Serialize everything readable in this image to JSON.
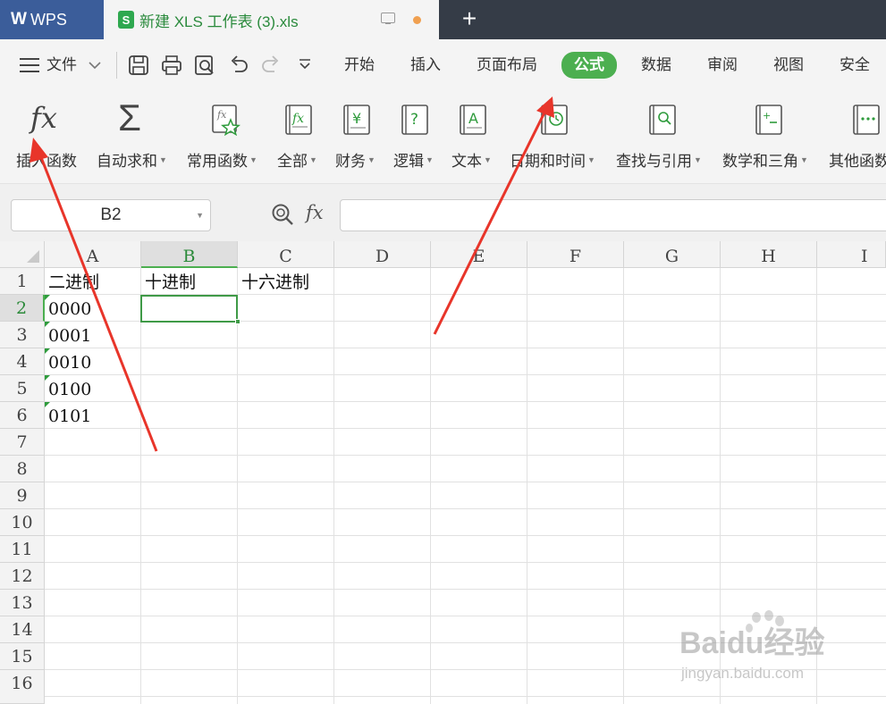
{
  "titlebar": {
    "app_name": "WPS",
    "logo": "W",
    "doc_icon_letter": "S",
    "doc_title": "新建 XLS 工作表 (3).xls",
    "new_tab_symbol": "+"
  },
  "menubar": {
    "file_label": "文件",
    "tabs": [
      "开始",
      "插入",
      "页面布局",
      "公式",
      "数据",
      "审阅",
      "视图",
      "安全"
    ],
    "active_tab": "公式"
  },
  "ribbon": {
    "buttons": [
      {
        "label": "插入函数",
        "icon": "fx-icon",
        "dropdown": false
      },
      {
        "label": "自动求和",
        "icon": "sigma-icon",
        "dropdown": true
      },
      {
        "label": "常用函数",
        "icon": "star-fx-icon",
        "dropdown": true
      },
      {
        "label": "全部",
        "icon": "fx-book-icon",
        "dropdown": true
      },
      {
        "label": "财务",
        "icon": "yen-book-icon",
        "dropdown": true
      },
      {
        "label": "逻辑",
        "icon": "question-book-icon",
        "dropdown": true
      },
      {
        "label": "文本",
        "icon": "a-book-icon",
        "dropdown": true
      },
      {
        "label": "日期和时间",
        "icon": "clock-book-icon",
        "dropdown": true
      },
      {
        "label": "查找与引用",
        "icon": "search-book-icon",
        "dropdown": true
      },
      {
        "label": "数学和三角",
        "icon": "plus-minus-book-icon",
        "dropdown": true
      },
      {
        "label": "其他函数",
        "icon": "more-book-icon",
        "dropdown": false
      }
    ],
    "sum_symbol": "Σ",
    "fx_symbol": "fx"
  },
  "formula_bar": {
    "name_box": "B2",
    "fx_label": "fx",
    "formula": ""
  },
  "sheet": {
    "columns": [
      "A",
      "B",
      "C",
      "D",
      "E",
      "F",
      "G",
      "H",
      "I"
    ],
    "rows": [
      "1",
      "2",
      "3",
      "4",
      "5",
      "6",
      "7",
      "8",
      "9",
      "10",
      "11",
      "12",
      "13",
      "14",
      "15",
      "16"
    ],
    "selected_column": "B",
    "selected_row": "2",
    "cells": {
      "A1": "二进制",
      "B1": "十进制",
      "C1": "十六进制",
      "A2": "0000",
      "A3": "0001",
      "A4": "0010",
      "A5": "0100",
      "A6": "0101"
    }
  },
  "colors": {
    "titlebar": "#353c47",
    "wps_tab": "#3b5d9a",
    "accent_green": "#4caf50",
    "arrow_red": "#e8352a"
  },
  "watermark": {
    "brand": "Baidu经验",
    "url": "jingyan.baidu.com"
  }
}
